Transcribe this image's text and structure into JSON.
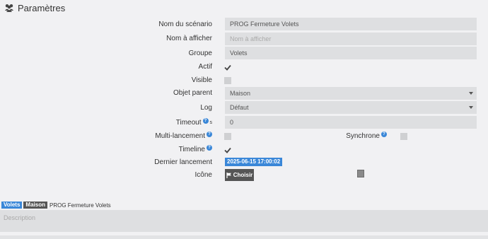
{
  "header": {
    "title": "Paramètres",
    "icon": "users-icon"
  },
  "form": {
    "name_label": "Nom du scénario",
    "name_value": "PROG Fermeture Volets",
    "display_label": "Nom à afficher",
    "display_placeholder": "Nom à afficher",
    "group_label": "Groupe",
    "group_value": "Volets",
    "active_label": "Actif",
    "active_checked": true,
    "visible_label": "Visible",
    "visible_checked": false,
    "parent_label": "Objet parent",
    "parent_value": "Maison",
    "log_label": "Log",
    "log_value": "Défaut",
    "timeout_label": "Timeout",
    "timeout_unit": "s",
    "timeout_value": "0",
    "multi_label": "Multi-lancement",
    "multi_checked": false,
    "sync_label": "Synchrone",
    "sync_checked": false,
    "timeline_label": "Timeline",
    "timeline_checked": true,
    "last_run_label": "Dernier lancement",
    "last_run_value": "2025-06-15 17:00:02",
    "icon_label": "Icône",
    "choose_label": "Choisir"
  },
  "breadcrumb": {
    "group": "Volets",
    "object": "Maison",
    "scenario": "PROG Fermeture Volets"
  },
  "description": {
    "placeholder": "Description"
  },
  "colors": {
    "accent": "#3a87d8",
    "dark_badge": "#555555",
    "field_bg": "#dedfe1",
    "page_bg": "#f1f1f3"
  }
}
